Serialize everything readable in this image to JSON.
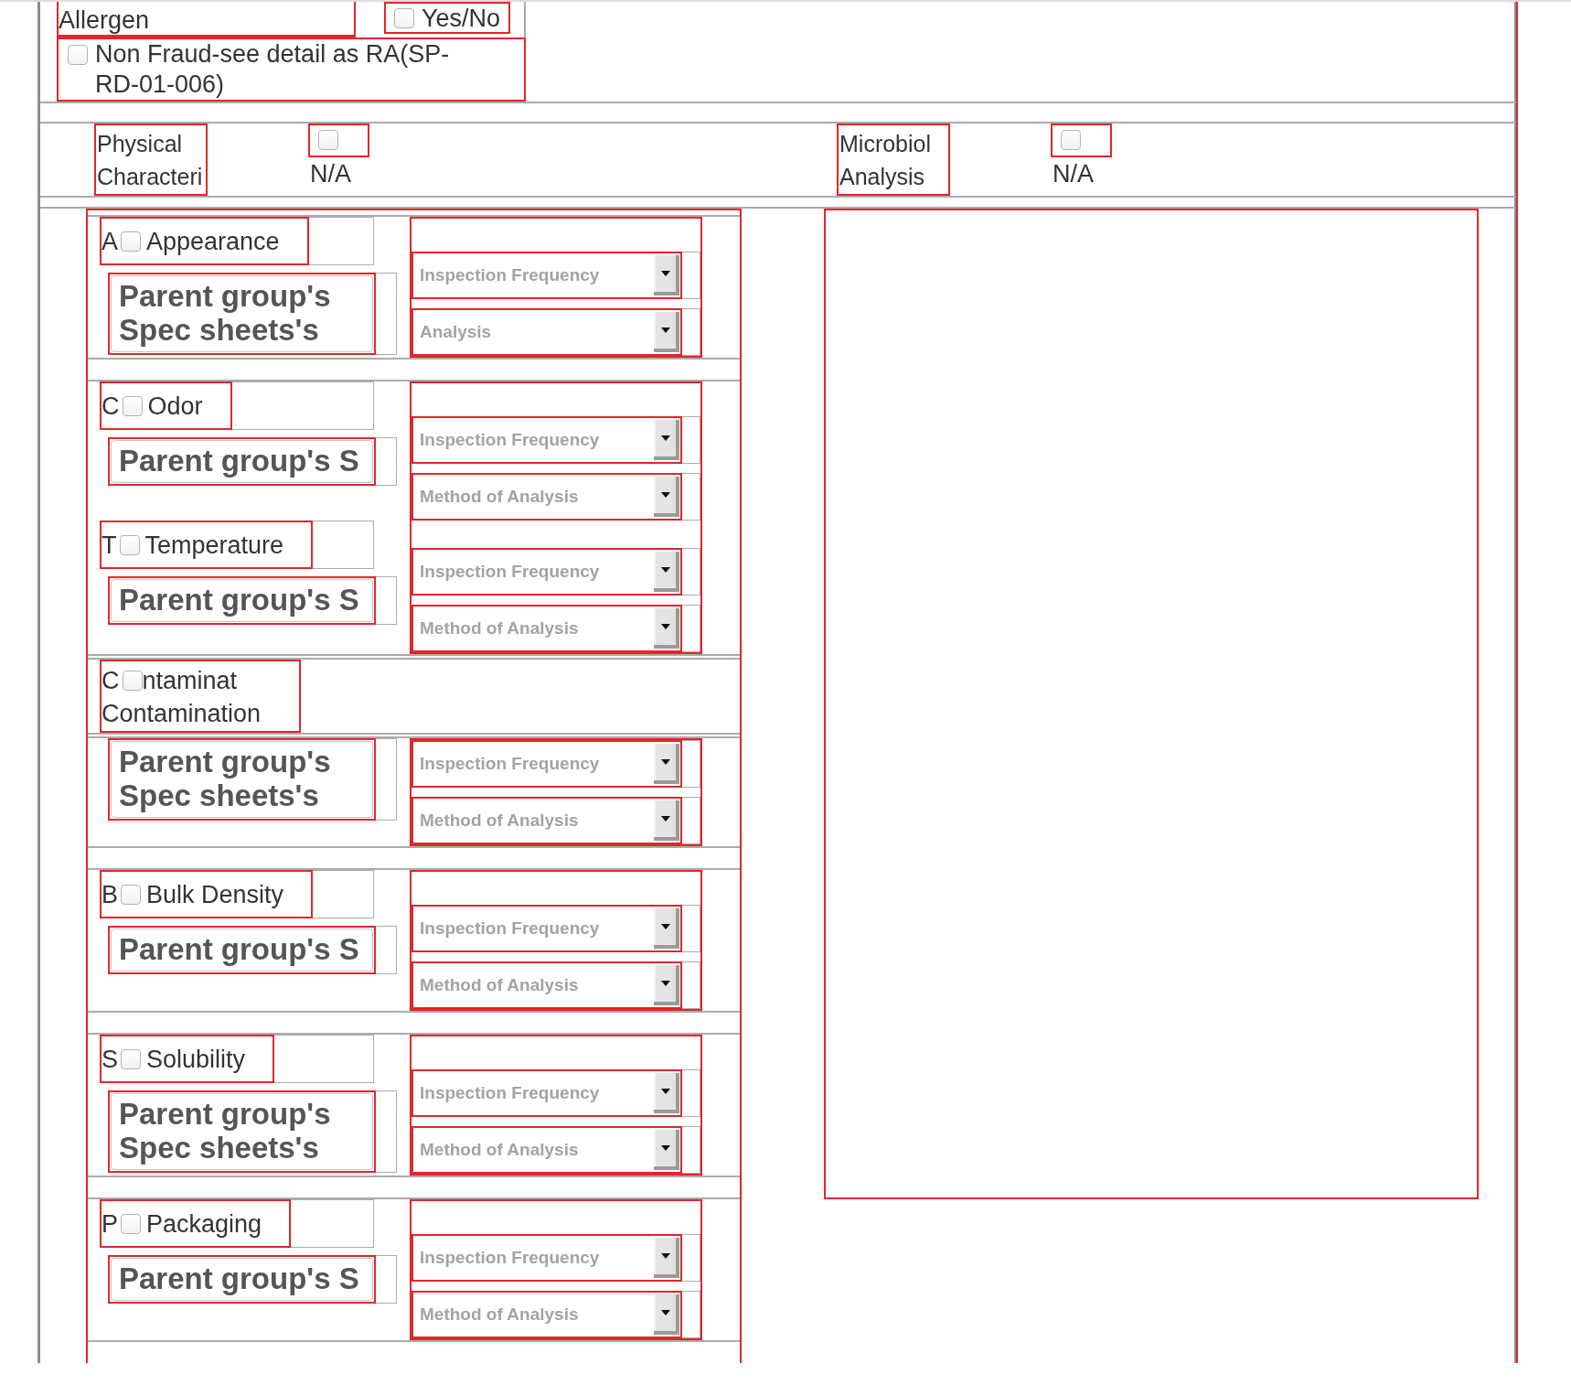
{
  "allergen": {
    "label": "Allergen",
    "yes_no": {
      "label": "Yes/No",
      "checked": false
    },
    "non_fraud": {
      "label": "Non Fraud-see detail as RA(SP-RD-01-006)",
      "checked": false
    }
  },
  "sections": [
    {
      "title": "Physical Characteri",
      "na": {
        "label": "N/A",
        "checked": false
      }
    },
    {
      "title": "Microbiol Analysis",
      "na": {
        "label": "N/A",
        "checked": false
      }
    }
  ],
  "physical_rows": [
    {
      "kind": "group",
      "items": [
        {
          "underlying_label_parts": [
            "A"
          ],
          "label": "Appearance",
          "checked": false,
          "spec": "Parent group's Spec sheets's",
          "selects": [
            {
              "placeholder": "Inspection Frequency"
            },
            {
              "placeholder": "Analysis"
            }
          ]
        }
      ]
    },
    {
      "kind": "group",
      "items": [
        {
          "underlying_label_parts": [
            "C"
          ],
          "label": "Odor",
          "checked": false,
          "spec": "Parent group's S",
          "selects": [
            {
              "placeholder": "Inspection Frequency"
            },
            {
              "placeholder": "Method of Analysis"
            }
          ]
        },
        {
          "underlying_label_parts": [
            "T"
          ],
          "label": "Temperature",
          "checked": false,
          "spec": "Parent group's S",
          "selects": [
            {
              "placeholder": "Inspection Frequency"
            },
            {
              "placeholder": "Method of Analysis"
            }
          ]
        }
      ]
    },
    {
      "kind": "heading",
      "underlying_label_parts": [
        "C",
        "ntaminat"
      ],
      "label": "Contamination",
      "checked": false
    },
    {
      "kind": "group",
      "items": [
        {
          "spec": "Parent group's Spec sheets's",
          "selects": [
            {
              "placeholder": "Inspection Frequency"
            },
            {
              "placeholder": "Method of Analysis"
            }
          ]
        }
      ]
    },
    {
      "kind": "group",
      "items": [
        {
          "underlying_label_parts": [
            "B"
          ],
          "label": "Bulk Density",
          "checked": false,
          "spec": "Parent group's S",
          "selects": [
            {
              "placeholder": "Inspection Frequency"
            },
            {
              "placeholder": "Method of Analysis"
            }
          ]
        }
      ]
    },
    {
      "kind": "group",
      "items": [
        {
          "underlying_label_parts": [
            "S"
          ],
          "label": "Solubility",
          "checked": false,
          "spec": "Parent group's Spec sheets's",
          "selects": [
            {
              "placeholder": "Inspection Frequency"
            },
            {
              "placeholder": "Method of Analysis"
            }
          ]
        }
      ]
    },
    {
      "kind": "group",
      "items": [
        {
          "underlying_label_parts": [
            "P"
          ],
          "label": "Packaging",
          "checked": false,
          "spec": "Parent group's S",
          "selects": [
            {
              "placeholder": "Inspection Frequency"
            },
            {
              "placeholder": "Method of Analysis"
            }
          ]
        }
      ]
    }
  ]
}
